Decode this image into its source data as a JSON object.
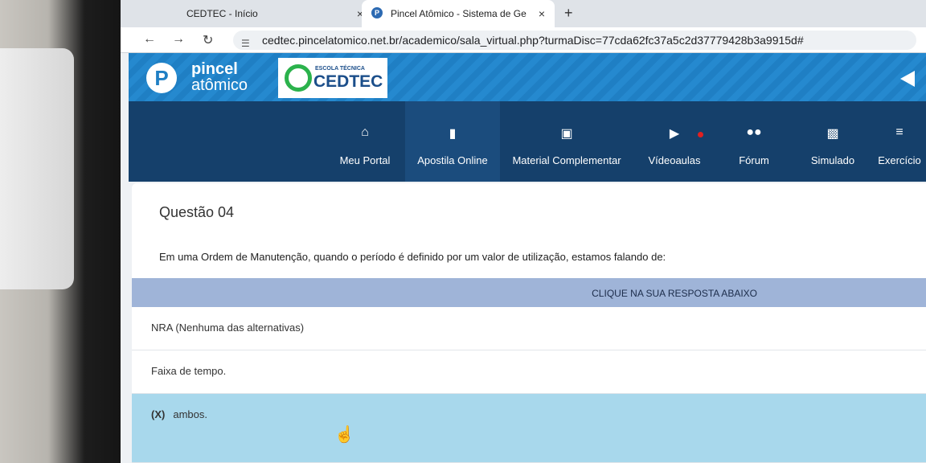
{
  "browser": {
    "tabs": [
      {
        "title": "CEDTEC - Início",
        "active": false
      },
      {
        "title": "Pincel Atômico - Sistema de Ge",
        "active": true
      }
    ],
    "new_tab_symbol": "+",
    "close_symbol": "×",
    "url": "cedtec.pincelatomico.net.br/academico/sala_virtual.php?turmaDisc=77cda62fc37a5c2d37779428b3a9915d#",
    "nav_icons": [
      "back-arrow-icon",
      "forward-arrow-icon",
      "reload-icon"
    ]
  },
  "header": {
    "logo_line1": "pincel",
    "logo_line2": "atômico",
    "logo_glyph": "P",
    "school_small": "ESCOLA TÉCNICA",
    "school_name": "CEDTEC",
    "colors": {
      "header_blue": "#1f7fc4",
      "nav_navy": "#15406b"
    }
  },
  "nav": {
    "items": [
      {
        "label": "Meu Portal",
        "icon": "home-icon"
      },
      {
        "label": "Apostila Online",
        "icon": "book-icon"
      },
      {
        "label": "Material Complementar",
        "icon": "briefcase-icon"
      },
      {
        "label": "Vídeoaulas",
        "icon": "video-icon"
      },
      {
        "label": "Fórum",
        "icon": "users-icon"
      },
      {
        "label": "Simulado",
        "icon": "clipboard-icon"
      },
      {
        "label": "Exercício",
        "icon": "list-icon"
      }
    ]
  },
  "question": {
    "title": "Questão 04",
    "text": "Em uma Ordem de Manutenção, quando o período é definido por um valor de utilização, estamos falando de:",
    "answer_header": "CLIQUE NA SUA RESPOSTA ABAIXO",
    "options": [
      {
        "text": "NRA (Nenhuma das alternativas)",
        "selected": false
      },
      {
        "text": "Faixa de tempo.",
        "selected": false
      },
      {
        "text": "ambos.",
        "selected": true,
        "mark": "(X)"
      }
    ],
    "selected_color": "#a8d8ec"
  }
}
